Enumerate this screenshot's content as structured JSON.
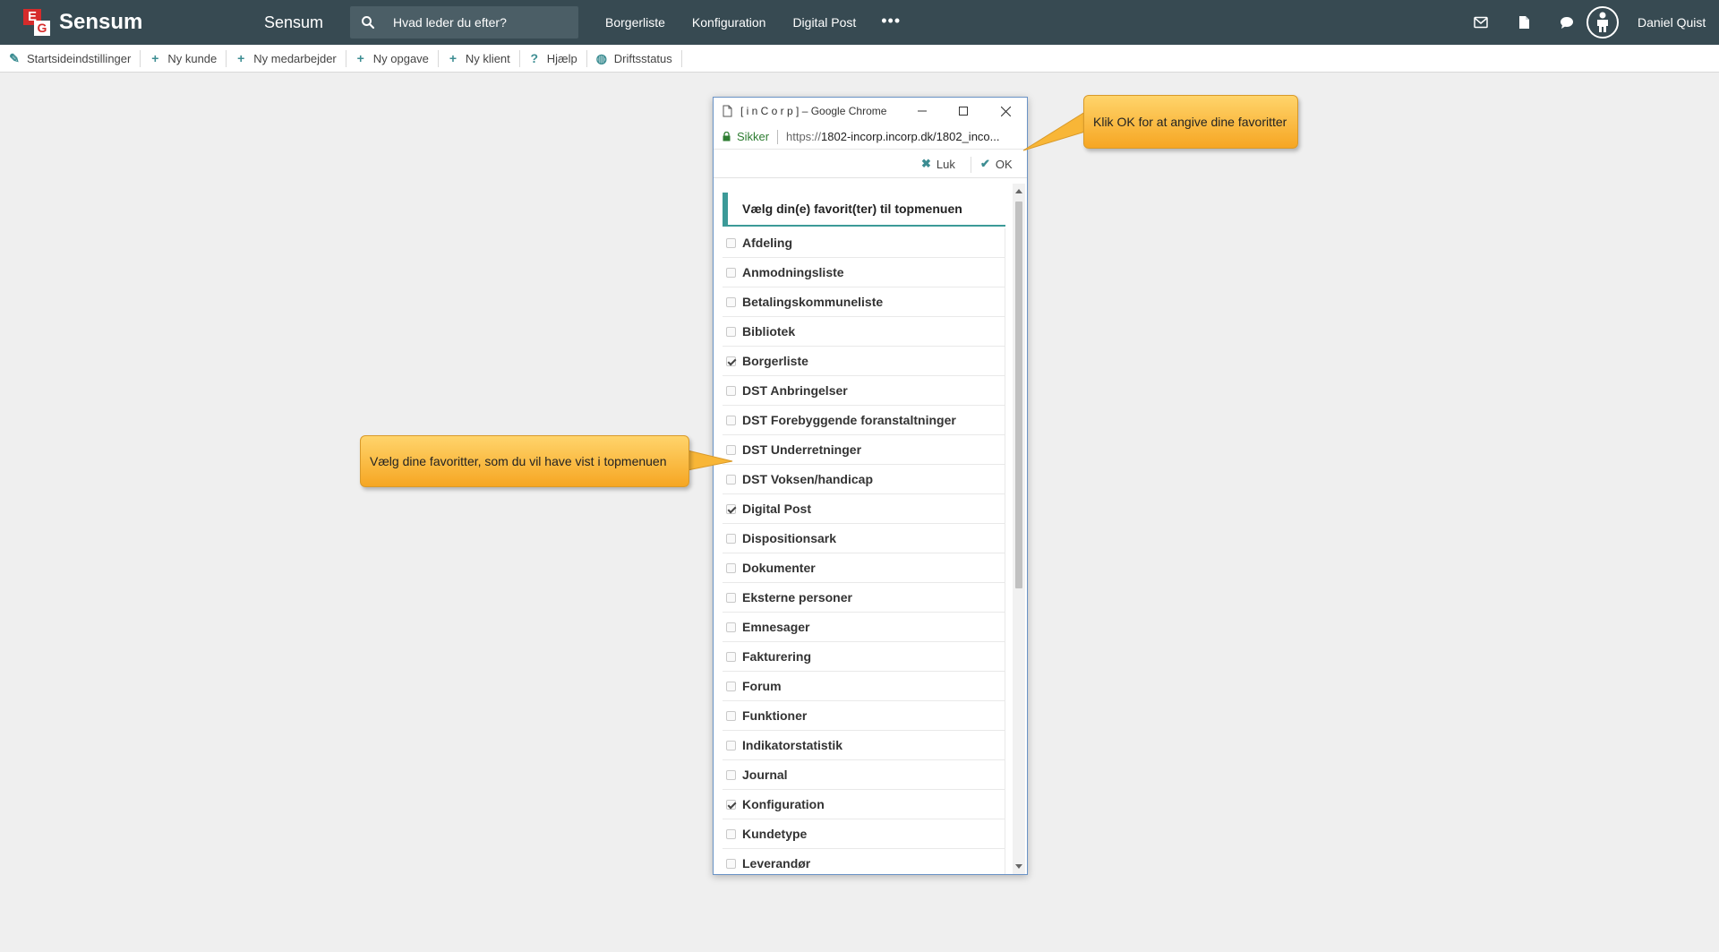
{
  "header": {
    "logo_e": "E",
    "logo_g": "G",
    "logo_text": "Sensum",
    "app_title": "Sensum",
    "search_placeholder": "Hvad leder du efter?",
    "nav": [
      "Borgerliste",
      "Konfiguration",
      "Digital Post"
    ],
    "more_label": "•••",
    "user_name": "Daniel Quist",
    "icons": [
      "mail-icon",
      "document-icon",
      "chat-icon",
      "user-avatar-icon"
    ]
  },
  "quickbar": {
    "items": [
      {
        "icon": "pencil-icon",
        "glyph": "✎",
        "label": "Startsideindstillinger"
      },
      {
        "icon": "plus-icon",
        "glyph": "+",
        "label": "Ny kunde"
      },
      {
        "icon": "plus-icon",
        "glyph": "+",
        "label": "Ny medarbejder"
      },
      {
        "icon": "plus-icon",
        "glyph": "+",
        "label": "Ny opgave"
      },
      {
        "icon": "plus-icon",
        "glyph": "+",
        "label": "Ny klient"
      },
      {
        "icon": "question-icon",
        "glyph": "?",
        "label": "Hjælp"
      },
      {
        "icon": "globe-icon",
        "glyph": "◍",
        "label": "Driftsstatus"
      }
    ]
  },
  "popup": {
    "window_title": "[ i n C o r p ] – Google Chrome",
    "secure_label": "Sikker",
    "url_scheme": "https://",
    "url_rest": "1802-incorp.incorp.dk/1802_inco...",
    "close_label": "Luk",
    "ok_label": "OK",
    "list_title": "Vælg din(e) favorit(ter) til topmenuen",
    "items": [
      {
        "label": "Afdeling",
        "checked": false
      },
      {
        "label": "Anmodningsliste",
        "checked": false
      },
      {
        "label": "Betalingskommuneliste",
        "checked": false
      },
      {
        "label": "Bibliotek",
        "checked": false
      },
      {
        "label": "Borgerliste",
        "checked": true
      },
      {
        "label": "DST Anbringelser",
        "checked": false
      },
      {
        "label": "DST Forebyggende foranstaltninger",
        "checked": false
      },
      {
        "label": "DST Underretninger",
        "checked": false
      },
      {
        "label": "DST Voksen/handicap",
        "checked": false
      },
      {
        "label": "Digital Post",
        "checked": true
      },
      {
        "label": "Dispositionsark",
        "checked": false
      },
      {
        "label": "Dokumenter",
        "checked": false
      },
      {
        "label": "Eksterne personer",
        "checked": false
      },
      {
        "label": "Emnesager",
        "checked": false
      },
      {
        "label": "Fakturering",
        "checked": false
      },
      {
        "label": "Forum",
        "checked": false
      },
      {
        "label": "Funktioner",
        "checked": false
      },
      {
        "label": "Indikatorstatistik",
        "checked": false
      },
      {
        "label": "Journal",
        "checked": false
      },
      {
        "label": "Konfiguration",
        "checked": true
      },
      {
        "label": "Kundetype",
        "checked": false
      },
      {
        "label": "Leverandør",
        "checked": false
      }
    ]
  },
  "tooltips": {
    "ok_hint": "Klik OK for at angive dine favoritter",
    "favorites_hint": "Vælg dine favoritter, som du vil have vist i topmenuen"
  },
  "colors": {
    "header_bg": "#374a52",
    "accent_teal": "#3c9a98",
    "tooltip": "#f6a623",
    "logo_red": "#d62b2b"
  }
}
